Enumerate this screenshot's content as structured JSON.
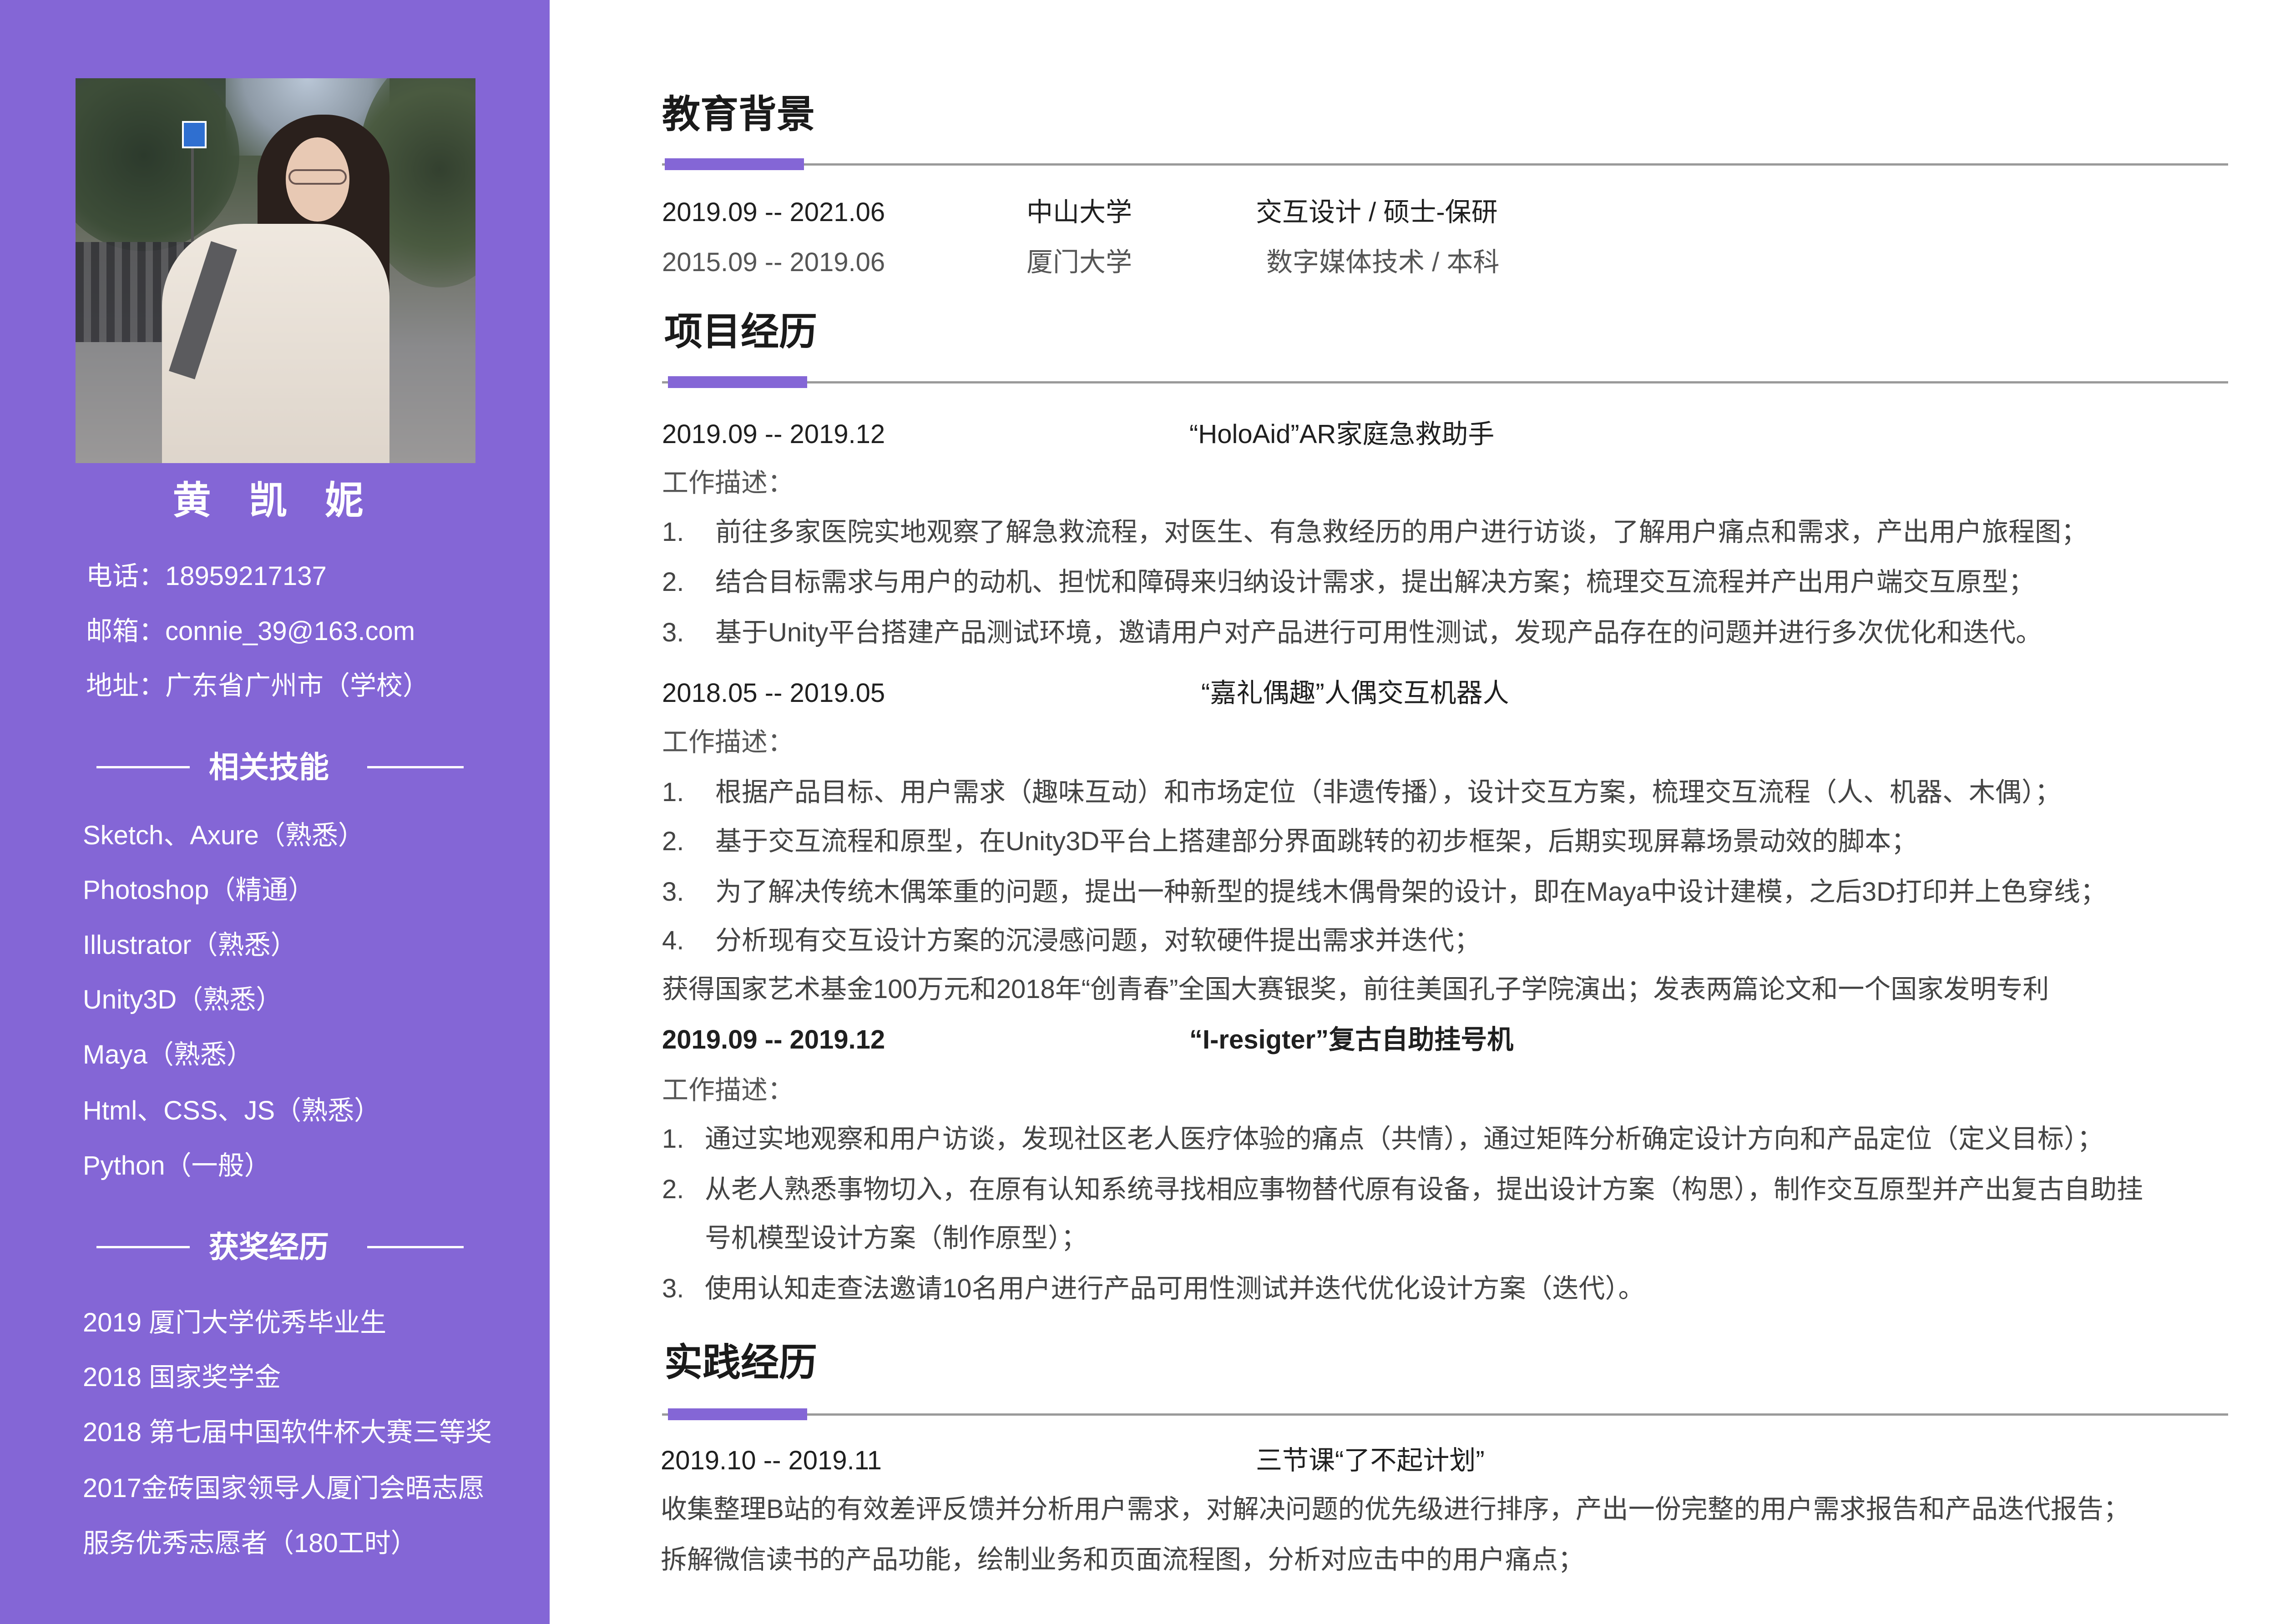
{
  "colors": {
    "accent": "#8466d6",
    "sidebar_text": "#ffffff",
    "rule": "#9a9a9a"
  },
  "sidebar": {
    "name": "黄 凯 妮",
    "contacts": [
      "电话：18959217137",
      "邮箱：connie_39@163.com",
      "地址：广东省广州市（学校）"
    ],
    "skills_heading": "相关技能",
    "skills": [
      "Sketch、Axure（熟悉）",
      "Photoshop（精通）",
      "Illustrator（熟悉）",
      "Unity3D（熟悉）",
      "Maya（熟悉）",
      "Html、CSS、JS（熟悉）",
      "Python（一般）"
    ],
    "awards_heading": "获奖经历",
    "awards": [
      "2019 厦门大学优秀毕业生",
      "2018 国家奖学金",
      "2018 第七届中国软件杯大赛三等奖",
      "2017金砖国家领导人厦门会晤志愿",
      "服务优秀志愿者（180工时）"
    ]
  },
  "main": {
    "education": {
      "heading": "教育背景",
      "rows": [
        {
          "date": "2019.09 -- 2021.06",
          "school": "中山大学",
          "degree": "交互设计 / 硕士-保研"
        },
        {
          "date": "2015.09 -- 2019.06",
          "school": "厦门大学",
          "degree": "数字媒体技术 / 本科"
        }
      ]
    },
    "projects": {
      "heading": "项目经历",
      "list": [
        {
          "date": "2019.09 -- 2019.12",
          "title": "“HoloAid”AR家庭急救助手",
          "desc_label": "工作描述：",
          "items": [
            {
              "num": "1.",
              "text": "前往多家医院实地观察了解急救流程，对医生、有急救经历的用户进行访谈，了解用户痛点和需求，产出用户旅程图；"
            },
            {
              "num": "2.",
              "text": "结合目标需求与用户的动机、担忧和障碍来归纳设计需求，提出解决方案；梳理交互流程并产出用户端交互原型；"
            },
            {
              "num": "3.",
              "text": "基于Unity平台搭建产品测试环境，邀请用户对产品进行可用性测试，发现产品存在的问题并进行多次优化和迭代。"
            }
          ]
        },
        {
          "date": "2018.05 -- 2019.05",
          "title": "“嘉礼偶趣”人偶交互机器人",
          "desc_label": "工作描述：",
          "items": [
            {
              "num": "1.",
              "text": "根据产品目标、用户需求（趣味互动）和市场定位（非遗传播），设计交互方案，梳理交互流程（人、机器、木偶）；"
            },
            {
              "num": "2.",
              "text": "基于交互流程和原型，在Unity3D平台上搭建部分界面跳转的初步框架，后期实现屏幕场景动效的脚本；"
            },
            {
              "num": "3.",
              "text": "为了解决传统木偶笨重的问题，提出一种新型的提线木偶骨架的设计，即在Maya中设计建模，之后3D打印并上色穿线；"
            },
            {
              "num": "4.",
              "text": "分析现有交互设计方案的沉浸感问题，对软硬件提出需求并迭代；"
            }
          ],
          "achievement": "获得国家艺术基金100万元和2018年“创青春”全国大赛银奖，前往美国孔子学院演出；发表两篇论文和一个国家发明专利"
        },
        {
          "date": "2019.09 -- 2019.12",
          "title": "“I-resigter”复古自助挂号机",
          "desc_label": "工作描述：",
          "items": [
            {
              "num": "1.",
              "text": "通过实地观察和用户访谈，发现社区老人医疗体验的痛点（共情），通过矩阵分析确定设计方向和产品定位（定义目标）；"
            },
            {
              "num": "2.",
              "text": "从老人熟悉事物切入，在原有认知系统寻找相应事物替代原有设备，提出设计方案（构思），制作交互原型并产出复古自助挂",
              "text_cont": "号机模型设计方案（制作原型）；"
            },
            {
              "num": "3.",
              "text": "使用认知走查法邀请10名用户进行产品可用性测试并迭代优化设计方案（迭代）。"
            }
          ]
        }
      ]
    },
    "practice": {
      "heading": "实践经历",
      "date": "2019.10 -- 2019.11",
      "title": "三节课“了不起计划”",
      "lines": [
        "收集整理B站的有效差评反馈并分析用户需求，对解决问题的优先级进行排序，产出一份完整的用户需求报告和产品迭代报告；",
        "拆解微信读书的产品功能，绘制业务和页面流程图，分析对应击中的用户痛点；"
      ]
    }
  }
}
